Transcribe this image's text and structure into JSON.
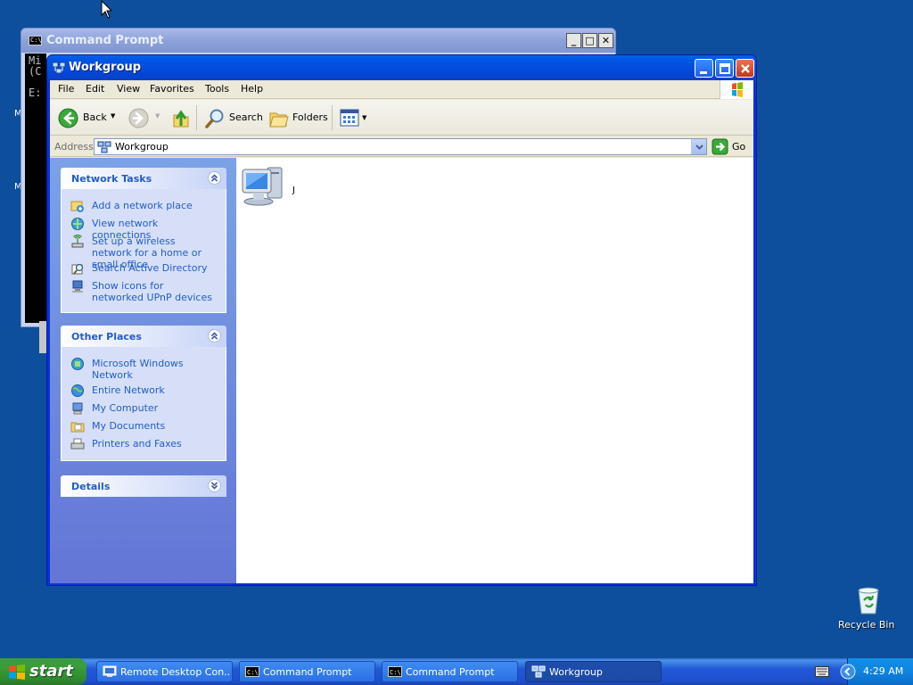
{
  "cmd_window": {
    "title": "Command Prompt",
    "lines": [
      "Mi",
      "(C",
      "E:"
    ]
  },
  "desktop_fragments": [
    "M",
    "M"
  ],
  "explorer": {
    "title": "Workgroup",
    "menu": [
      "File",
      "Edit",
      "View",
      "Favorites",
      "Tools",
      "Help"
    ],
    "toolbar": {
      "back_label": "Back",
      "search_label": "Search",
      "folders_label": "Folders"
    },
    "address": {
      "label": "Address",
      "value": "Workgroup",
      "go_label": "Go"
    },
    "network_tasks": {
      "header": "Network Tasks",
      "items": [
        {
          "label": "Add a network place",
          "icon": "add-network-place-icon"
        },
        {
          "label": "View network connections",
          "icon": "network-connections-icon"
        },
        {
          "label": "Set up a wireless network for a home or small office",
          "icon": "wireless-network-icon"
        },
        {
          "label": "Search Active Directory",
          "icon": "search-directory-icon"
        },
        {
          "label": "Show icons for networked UPnP devices",
          "icon": "upnp-devices-icon"
        }
      ]
    },
    "other_places": {
      "header": "Other Places",
      "items": [
        {
          "label": "Microsoft Windows Network",
          "icon": "windows-network-icon"
        },
        {
          "label": "Entire Network",
          "icon": "entire-network-icon"
        },
        {
          "label": "My Computer",
          "icon": "my-computer-icon"
        },
        {
          "label": "My Documents",
          "icon": "my-documents-icon"
        },
        {
          "label": "Printers and Faxes",
          "icon": "printers-faxes-icon"
        }
      ]
    },
    "details": {
      "header": "Details"
    },
    "items": [
      {
        "label": "J",
        "icon": "network-computer-icon"
      }
    ]
  },
  "desktop": {
    "recycle_bin_label": "Recycle Bin"
  },
  "taskbar": {
    "start_label": "start",
    "buttons": [
      {
        "label": "Remote Desktop Con...",
        "icon": "remote-desktop-icon",
        "active": false
      },
      {
        "label": "Command Prompt",
        "icon": "command-prompt-icon",
        "active": false
      },
      {
        "label": "Command Prompt",
        "icon": "command-prompt-icon",
        "active": false
      },
      {
        "label": "Workgroup",
        "icon": "network-icon",
        "active": true
      }
    ],
    "clock": "4:29 AM"
  },
  "colors": {
    "desktop": "#0d4f9c",
    "title_blue": "#0055e5",
    "link_blue": "#215dc6",
    "start_green": "#3a9d3a"
  }
}
